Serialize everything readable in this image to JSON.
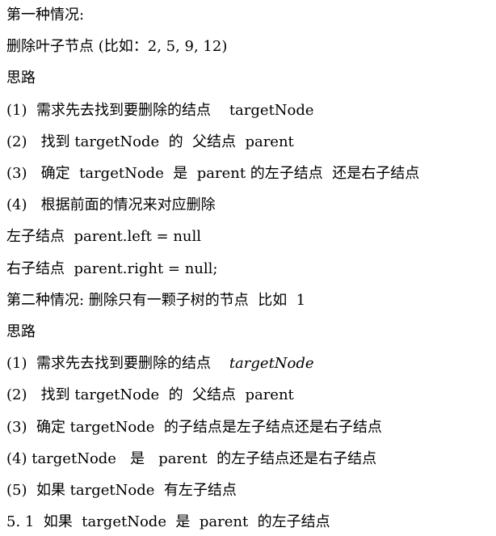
{
  "document": {
    "lines": [
      "第一种情况:",
      "删除叶子节点 (比如：2, 5, 9, 12)",
      "思路",
      "(1)  需求先去找到要删除的结点    targetNode",
      "(2)   找到 targetNode  的  父结点  parent",
      "(3)   确定  targetNode  是  parent 的左子结点  还是右子结点",
      "(4)   根据前面的情况来对应删除",
      "左子结点  parent.left = null",
      "右子结点  parent.right = null;",
      "第二种情况: 删除只有一颗子树的节点  比如  1",
      "思路",
      "(1)  需求先去找到要删除的结点    ",
      "(2)   找到 targetNode  的  父结点  parent",
      "(3)  确定 targetNode  的子结点是左子结点还是右子结点",
      "(4) targetNode   是   parent  的左子结点还是右子结点",
      "(5)  如果 targetNode  有左子结点",
      "5. 1  如果  targetNode  是  parent  的左子结点"
    ],
    "italic_fragment": "targetNode"
  }
}
